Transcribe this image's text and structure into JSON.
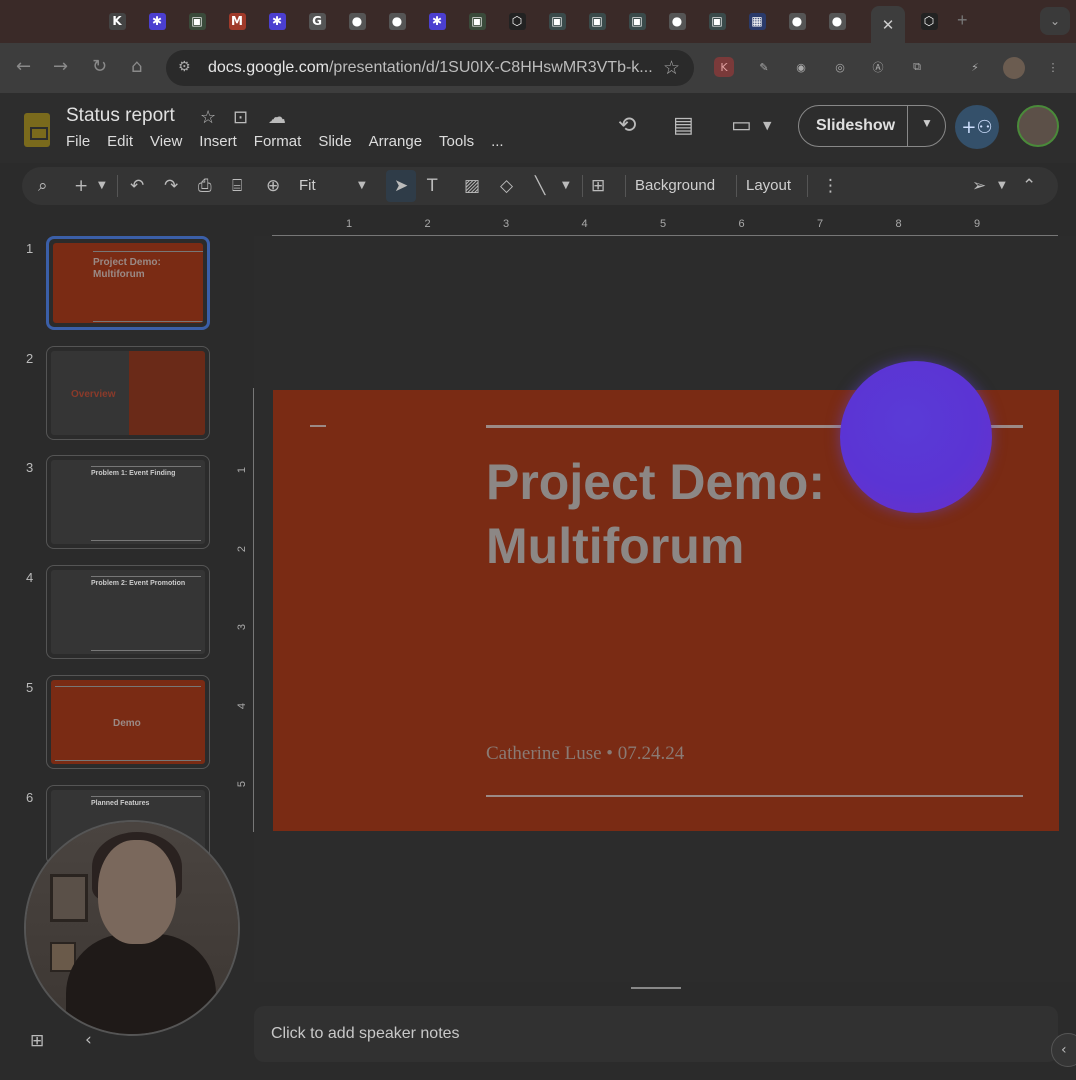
{
  "browser": {
    "tabs": [
      {
        "icon": "notion-icon",
        "glyph": "K",
        "color": "#444"
      },
      {
        "icon": "linear-icon",
        "glyph": "✱",
        "color": "#4b3fd0"
      },
      {
        "icon": "app-icon",
        "glyph": "▣",
        "color": "#3a4a3a"
      },
      {
        "icon": "gmail-icon",
        "glyph": "M",
        "color": "#a03a2a"
      },
      {
        "icon": "linear-icon",
        "glyph": "✱",
        "color": "#4b3fd0"
      },
      {
        "icon": "google-icon",
        "glyph": "G",
        "color": "#555"
      },
      {
        "icon": "github-icon",
        "glyph": "●",
        "color": "#555"
      },
      {
        "icon": "github-icon",
        "glyph": "●",
        "color": "#555"
      },
      {
        "icon": "linear-icon",
        "glyph": "✱",
        "color": "#4b3fd0"
      },
      {
        "icon": "app-icon",
        "glyph": "▣",
        "color": "#3a4a3a"
      },
      {
        "icon": "cube-icon",
        "glyph": "⬡",
        "color": "#222"
      },
      {
        "icon": "app-icon",
        "glyph": "▣",
        "color": "#3a4a4a"
      },
      {
        "icon": "app-icon",
        "glyph": "▣",
        "color": "#3a4a4a"
      },
      {
        "icon": "app-icon",
        "glyph": "▣",
        "color": "#3a4a4a"
      },
      {
        "icon": "github-icon",
        "glyph": "●",
        "color": "#555"
      },
      {
        "icon": "app-icon",
        "glyph": "▣",
        "color": "#3a4a4a"
      },
      {
        "icon": "calendar-icon",
        "glyph": "▦",
        "color": "#2a3a6a"
      },
      {
        "icon": "github-icon",
        "glyph": "●",
        "color": "#555"
      },
      {
        "icon": "github-icon",
        "glyph": "●",
        "color": "#555"
      }
    ],
    "active_tab_close": "✕",
    "new_tab": "+",
    "url_host": "docs.google.com",
    "url_path": "/presentation/d/1SU0IX-C8HHswMR3VTb-k..."
  },
  "app": {
    "title": "Status report",
    "menu": [
      "File",
      "Edit",
      "View",
      "Insert",
      "Format",
      "Slide",
      "Arrange",
      "Tools",
      "..."
    ],
    "slideshow_label": "Slideshow"
  },
  "toolbar": {
    "zoom": "Fit",
    "background": "Background",
    "layout": "Layout"
  },
  "ruler": {
    "h": [
      "1",
      "2",
      "3",
      "4",
      "5",
      "6",
      "7",
      "8",
      "9"
    ],
    "v": [
      "1",
      "2",
      "3",
      "4",
      "5"
    ]
  },
  "slides": [
    {
      "num": "1",
      "title": "Project Demo: Multiforum",
      "subtitle": "Catherine Luse • 07.24.24"
    },
    {
      "num": "2",
      "title": "Overview"
    },
    {
      "num": "3",
      "title": "Problem 1: Event Finding"
    },
    {
      "num": "4",
      "title": "Problem 2: Event Promotion"
    },
    {
      "num": "5",
      "title": "Demo"
    },
    {
      "num": "6",
      "title": "Planned Features"
    }
  ],
  "current_slide": {
    "title": "Project Demo: Multiforum",
    "subtitle": "Catherine Luse • 07.24.24"
  },
  "notes": {
    "placeholder": "Click to add speaker notes"
  },
  "colors": {
    "slide_bg": "#7a2b14",
    "pointer": "#5b34d4",
    "accent_select": "#3b5fa8"
  }
}
